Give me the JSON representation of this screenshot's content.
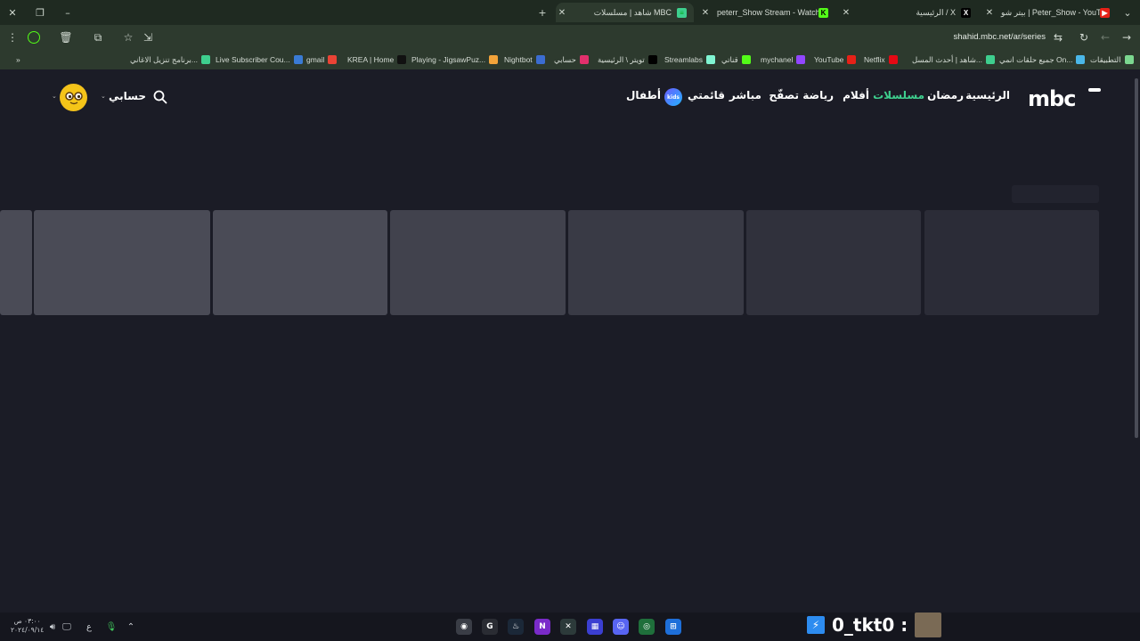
{
  "browser": {
    "tabs": [
      {
        "title": "بيتر شو | Peter_Show - YouTube",
        "favicon": "youtube-icon",
        "color": "#e62117",
        "active": false
      },
      {
        "title": "الرئيسية / X",
        "favicon": "x-icon",
        "color": "#000000",
        "active": false
      },
      {
        "title": "peterr_Show Stream - Watch Li",
        "favicon": "kick-icon",
        "color": "#53fc18",
        "active": false
      },
      {
        "title": "شاهد | مسلسلات MBC",
        "favicon": "shahid-icon",
        "color": "#3ecf8e",
        "active": true
      }
    ],
    "new_tab_label": "+",
    "url": "shahid.mbc.net/ar/series",
    "bookmarks": [
      {
        "label": "التطبيقات",
        "color": "#7bd88f"
      },
      {
        "label": "جميع حلقات انمي On...",
        "color": "#4ab7e8"
      },
      {
        "label": "شاهد | أحدث المسل...",
        "color": "#3ecf8e"
      },
      {
        "label": "Netflix",
        "color": "#e50914"
      },
      {
        "label": "YouTube",
        "color": "#e62117"
      },
      {
        "label": "mychanel",
        "color": "#9146ff"
      },
      {
        "label": "قناتي",
        "color": "#53fc18"
      },
      {
        "label": "Streamlabs",
        "color": "#80f5d2"
      },
      {
        "label": "تويتر \\ الرئيسية",
        "color": "#000000"
      },
      {
        "label": "حسابي",
        "color": "#e1306c"
      },
      {
        "label": "Nightbot",
        "color": "#3b6cd1"
      },
      {
        "label": "Playing - JigsawPuz...",
        "color": "#f2a33a"
      },
      {
        "label": "KREA | Home",
        "color": "#111111"
      },
      {
        "label": "gmail",
        "color": "#ea4335"
      },
      {
        "label": "Live Subscriber Cou...",
        "color": "#3a7bd5"
      },
      {
        "label": "برنامج تنزيل الاغاني...",
        "color": "#3ecf8e"
      }
    ],
    "bookmarks_more": "»"
  },
  "site": {
    "logo_text": "mbc",
    "nav": [
      {
        "label": "الرئيسية",
        "active": false
      },
      {
        "label": "رمضان",
        "active": false
      },
      {
        "label": "مسلسلات",
        "active": true
      },
      {
        "label": "أفلام",
        "active": false
      },
      {
        "label": "رياضة",
        "active": false
      },
      {
        "label": "تصفّح",
        "active": false
      },
      {
        "label": "مباشر",
        "active": false
      },
      {
        "label": "قائمتي",
        "active": false
      },
      {
        "label": "أطفال",
        "active": false
      }
    ],
    "kids_badge": "kids",
    "account_label": "حسابي",
    "accent_color": "#3ecf8e"
  },
  "skeleton_colors": [
    "#4a4b56",
    "#4a4b56",
    "#4a4b56",
    "#41424d",
    "#393a45",
    "#30313c",
    "#2b2c37"
  ],
  "taskbar": {
    "time": "٠٣:٠٠ ص",
    "date": "٢٠٢٤/٠٩/١٤",
    "lang": "ع",
    "overlay_username": "0_tkt0 :"
  }
}
